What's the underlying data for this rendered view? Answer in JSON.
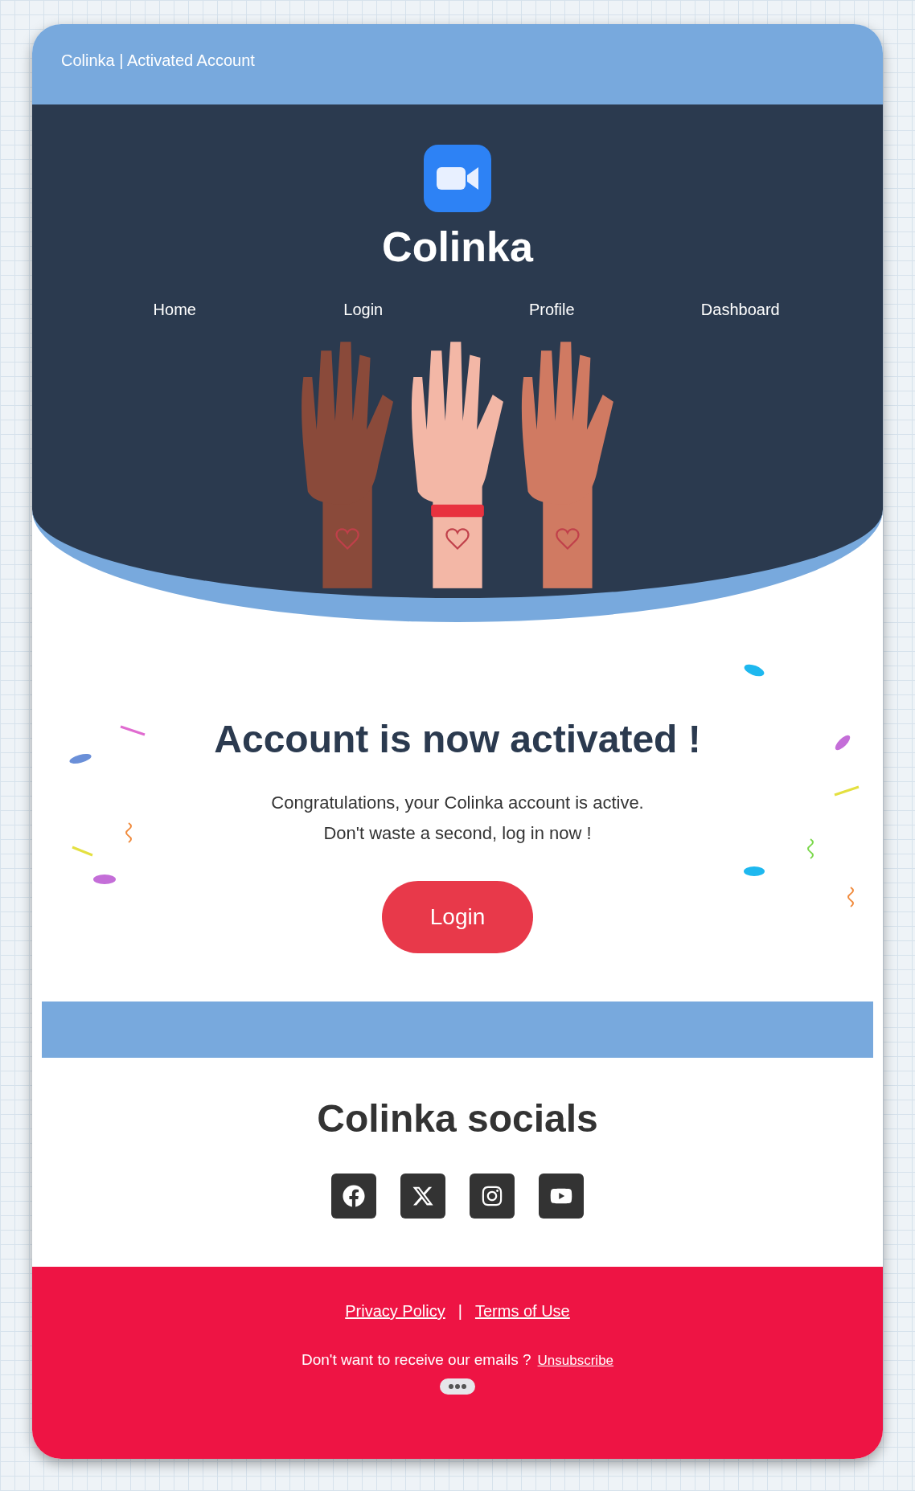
{
  "email": {
    "subject": "Colinka | Activated Account"
  },
  "header": {
    "brand": "Colinka",
    "nav": [
      {
        "label": "Home"
      },
      {
        "label": "Login"
      },
      {
        "label": "Profile"
      },
      {
        "label": "Dashboard"
      }
    ]
  },
  "message": {
    "title": "Account is now activated !",
    "lines": [
      "Congratulations, your Colinka account is active.",
      "Don't waste a second, log in now !"
    ],
    "button": "Login"
  },
  "socials": {
    "title": "Colinka socials",
    "links": [
      {
        "kind": "facebook"
      },
      {
        "kind": "x"
      },
      {
        "kind": "instagram"
      },
      {
        "kind": "youtube"
      }
    ]
  },
  "footer": {
    "links": [
      "Privacy Policy",
      "Terms of Use"
    ],
    "separator": "|",
    "unsubscribe_text": "Don't want to receive our emails ?",
    "unsubscribe_link": "Unsubscribe"
  }
}
